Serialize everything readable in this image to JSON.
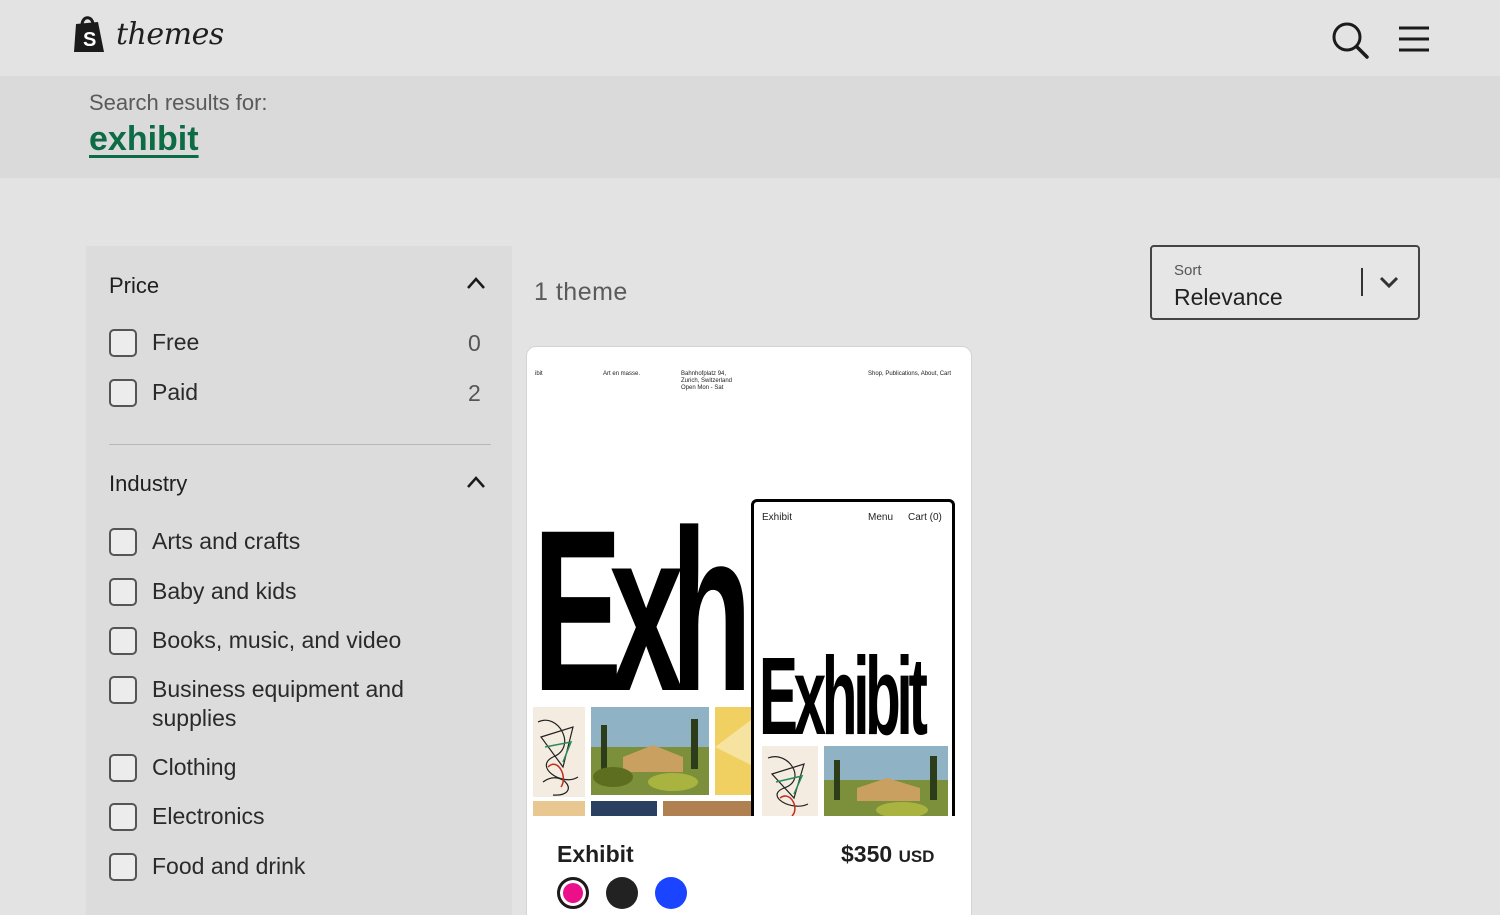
{
  "header": {
    "logo_text": "themes",
    "search_label": "Search",
    "menu_label": "Menu"
  },
  "search": {
    "label": "Search results for:",
    "query": "exhibit"
  },
  "filters": {
    "price": {
      "title": "Price",
      "options": [
        {
          "label": "Free",
          "count": "0"
        },
        {
          "label": "Paid",
          "count": "2"
        }
      ]
    },
    "industry": {
      "title": "Industry",
      "options": [
        {
          "label": "Arts and crafts"
        },
        {
          "label": "Baby and kids"
        },
        {
          "label": "Books, music, and video"
        },
        {
          "label": "Business equipment and supplies"
        },
        {
          "label": "Clothing"
        },
        {
          "label": "Electronics"
        },
        {
          "label": "Food and drink"
        }
      ]
    }
  },
  "results": {
    "count_text": "1 theme",
    "sort": {
      "label": "Sort",
      "value": "Relevance"
    }
  },
  "theme_card": {
    "name": "Exhibit",
    "price": "$350",
    "currency": "USD",
    "preview": {
      "nav_left": "ibit",
      "nav_tagline": "Art en masse.",
      "nav_address": [
        "Bahnhofplatz 94,",
        "Zurich, Switzerland",
        "Open Mon - Sat"
      ],
      "nav_links": "Shop,  Publications,  About,  Cart",
      "big_word": "Exh",
      "mobile_brand": "Exhibit",
      "mobile_menu": "Menu",
      "mobile_cart": "Cart (0)",
      "mobile_word": "Exhibit"
    },
    "swatches": [
      {
        "name": "pink",
        "color": "#ec0f8a"
      },
      {
        "name": "black",
        "color": "#222222"
      },
      {
        "name": "blue",
        "color": "#1a44ff"
      }
    ]
  },
  "colors": {
    "accent_green": "#0d6b46",
    "background": "#e3e3e3"
  }
}
